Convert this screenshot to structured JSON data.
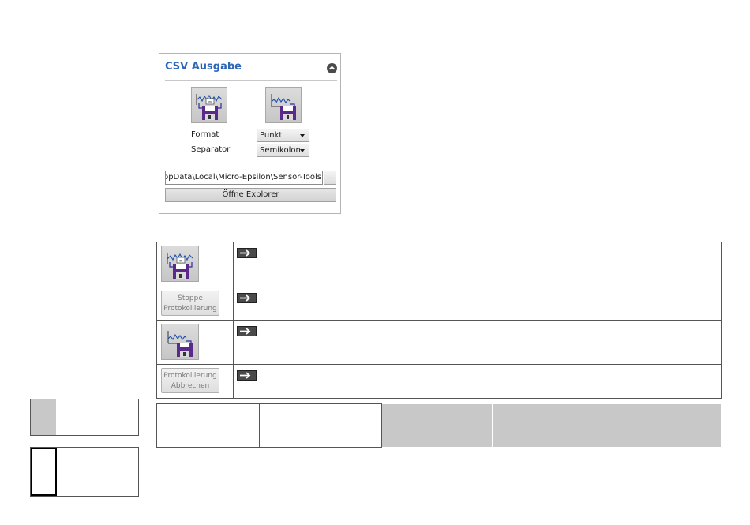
{
  "panel": {
    "title": "CSV Ausgabe",
    "format_label": "Format",
    "format_value": "Punkt",
    "separator_label": "Separator",
    "separator_value": "Semikolon",
    "path_value": "C:\\Users\\AppData\\Local\\Micro-Epsilon\\Sensor-Tools",
    "browse_label": "...",
    "explorer_button": "Öffne Explorer"
  },
  "table": {
    "stop_logging_button": "Stoppe Protokollierung",
    "cancel_logging_button": "Protokollierung Abbrechen"
  },
  "icons": {
    "start": "start-logging-icon",
    "save": "save-snapshot-icon",
    "arrow": "arrow-right-icon",
    "collapse": "chevron-up-icon"
  }
}
